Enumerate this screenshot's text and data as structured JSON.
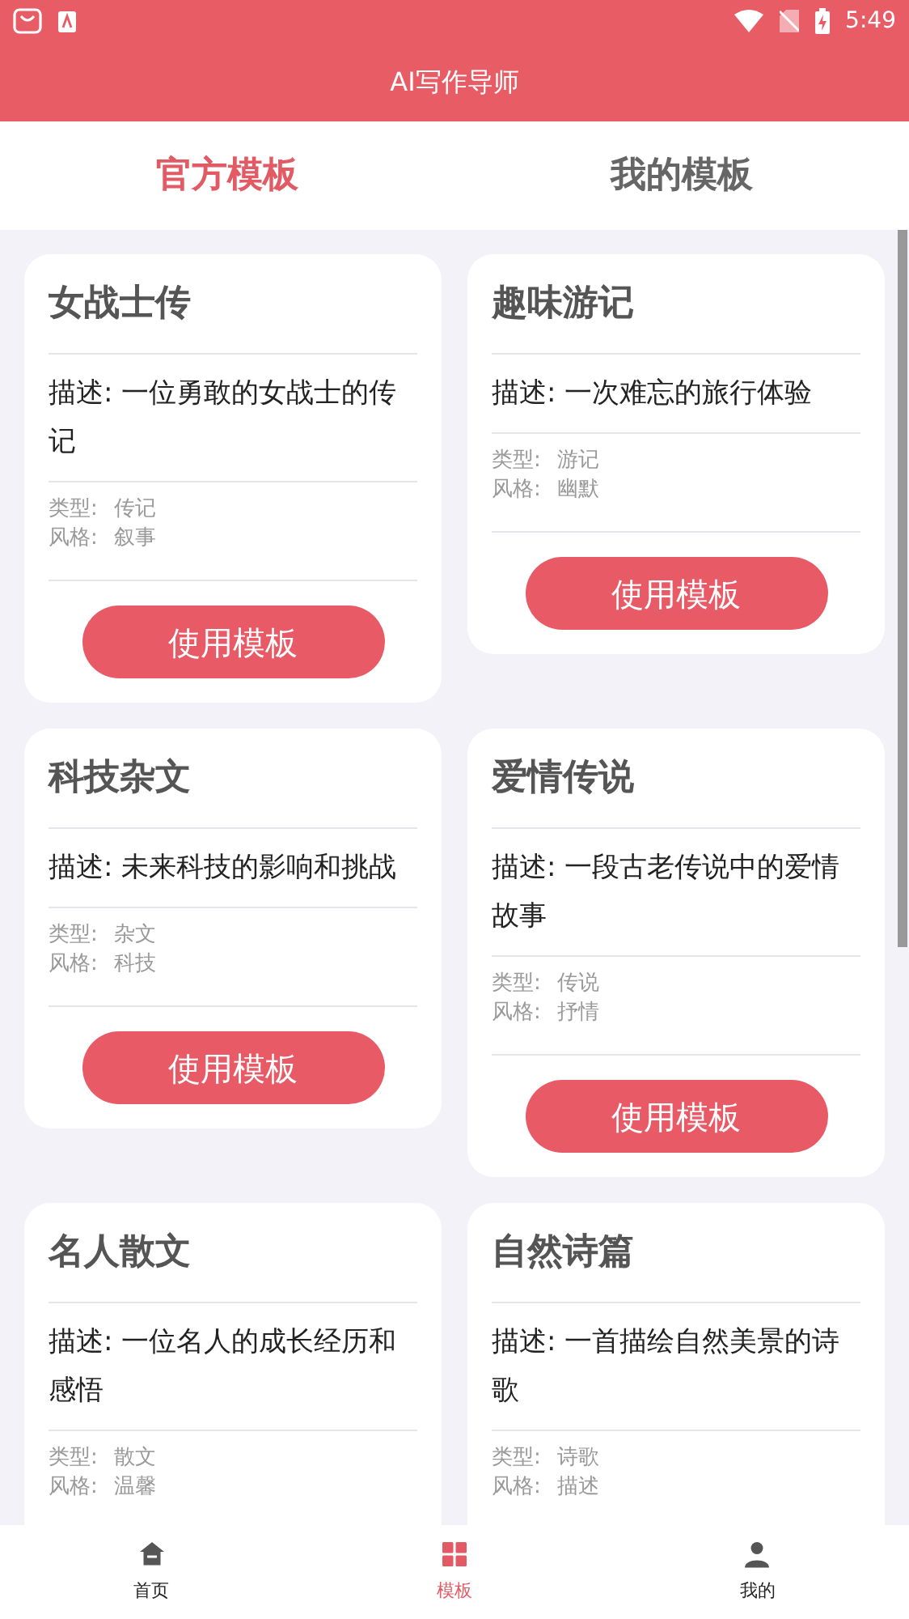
{
  "status_bar": {
    "time": "5:49"
  },
  "header": {
    "title": "AI写作导师"
  },
  "tabs": [
    {
      "label": "官方模板",
      "selected": true
    },
    {
      "label": "我的模板",
      "selected": false
    }
  ],
  "templates": [
    {
      "title": "女战士传",
      "description": "描述: 一位勇敢的女战士的传记",
      "type_label": "类型:",
      "type": "传记",
      "style_label": "风格:",
      "style": "叙事",
      "button": "使用模板"
    },
    {
      "title": "趣味游记",
      "description": "描述: 一次难忘的旅行体验",
      "type_label": "类型:",
      "type": "游记",
      "style_label": "风格:",
      "style": "幽默",
      "button": "使用模板"
    },
    {
      "title": "科技杂文",
      "description": "描述: 未来科技的影响和挑战",
      "type_label": "类型:",
      "type": "杂文",
      "style_label": "风格:",
      "style": "科技",
      "button": "使用模板"
    },
    {
      "title": "爱情传说",
      "description": "描述: 一段古老传说中的爱情故事",
      "type_label": "类型:",
      "type": "传说",
      "style_label": "风格:",
      "style": "抒情",
      "button": "使用模板"
    },
    {
      "title": "名人散文",
      "description": "描述: 一位名人的成长经历和感悟",
      "type_label": "类型:",
      "type": "散文",
      "style_label": "风格:",
      "style": "温馨"
    },
    {
      "title": "自然诗篇",
      "description": "描述: 一首描绘自然美景的诗歌",
      "type_label": "类型:",
      "type": "诗歌",
      "style_label": "风格:",
      "style": "描述"
    }
  ],
  "bottom_nav": [
    {
      "label": "首页",
      "kind": "home",
      "selected": false
    },
    {
      "label": "模板",
      "kind": "grid",
      "selected": true
    },
    {
      "label": "我的",
      "kind": "person",
      "selected": false
    }
  ]
}
